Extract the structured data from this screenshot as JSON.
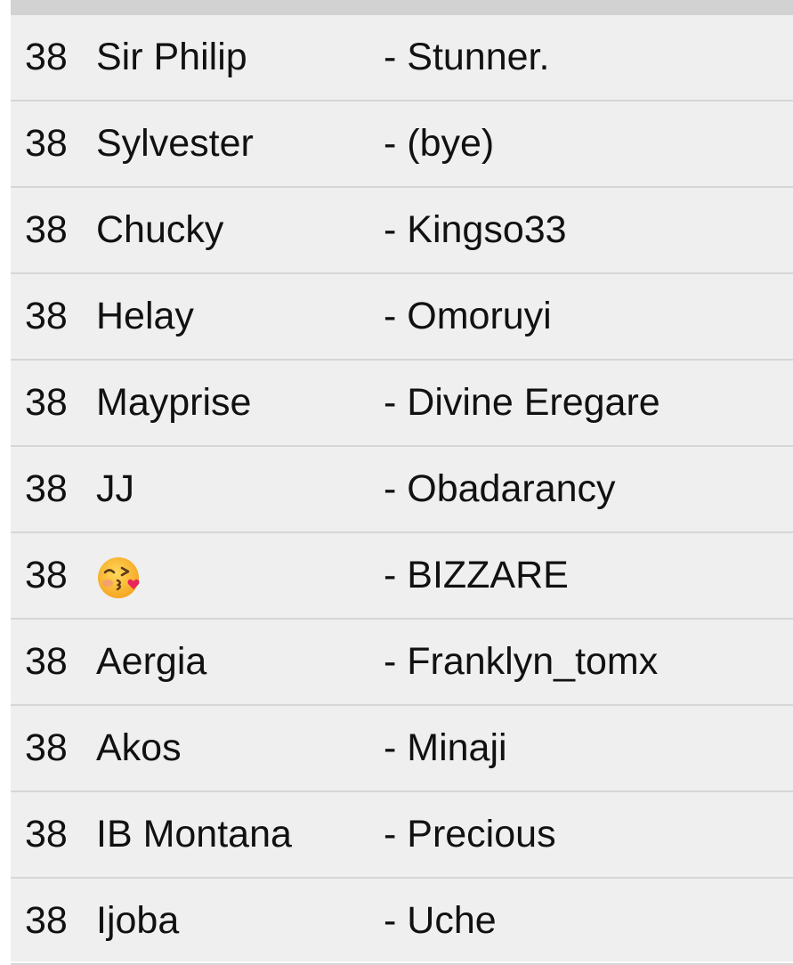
{
  "list": {
    "rows": [
      {
        "number": "38",
        "name": "Sir Philip",
        "partner": "- Stunner."
      },
      {
        "number": "38",
        "name": "Sylvester",
        "partner": "- (bye)"
      },
      {
        "number": "38",
        "name": "Chucky",
        "partner": "- Kingso33"
      },
      {
        "number": "38",
        "name": "Helay",
        "partner": "- Omoruyi"
      },
      {
        "number": "38",
        "name": "Mayprise",
        "partner": "- Divine Eregare"
      },
      {
        "number": "38",
        "name": "JJ",
        "partner": "- Obadarancy"
      },
      {
        "number": "38",
        "name": "",
        "icon": "kissing-face-emoji-icon",
        "partner": "- BIZZARE"
      },
      {
        "number": "38",
        "name": "Aergia",
        "partner": "- Franklyn_tomx"
      },
      {
        "number": "38",
        "name": "Akos",
        "partner": "- Minaji"
      },
      {
        "number": "38",
        "name": "IB Montana",
        "partner": "- Precious"
      },
      {
        "number": "38",
        "name": "Ijoba",
        "partner": "- Uche"
      }
    ]
  },
  "colors": {
    "background": "#efefef",
    "divider": "#d6d6d6",
    "text": "#111111",
    "top_strip": "#d2d2d2"
  }
}
